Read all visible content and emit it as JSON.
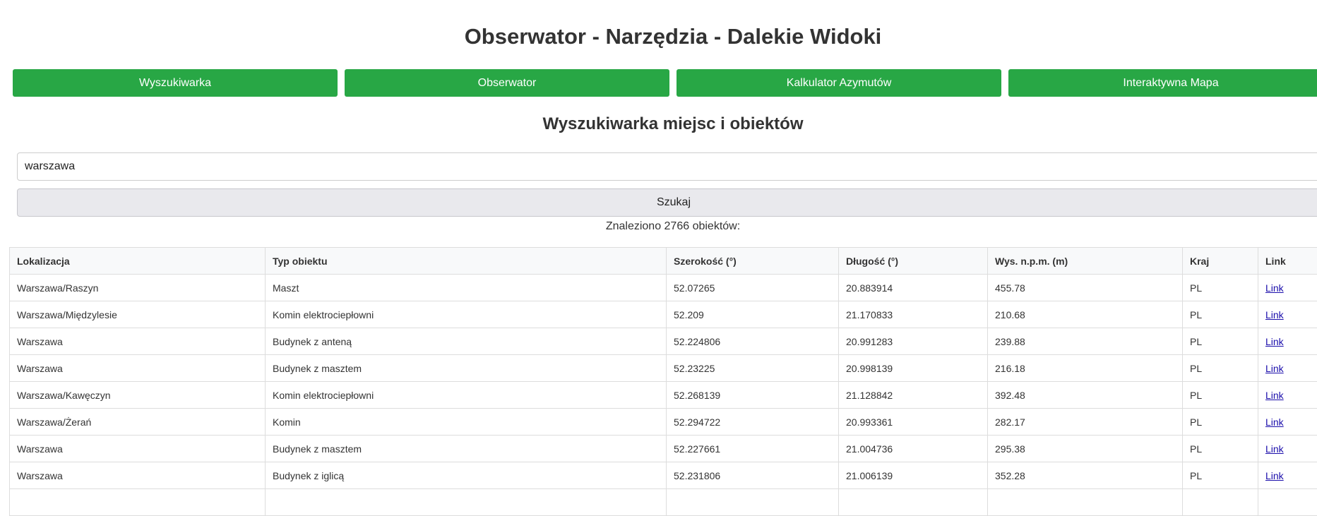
{
  "page": {
    "title": "Obserwator - Narzędzia - Dalekie Widoki",
    "section_title": "Wyszukiwarka miejsc i obiektów"
  },
  "nav": {
    "items": [
      "Wyszukiwarka",
      "Obserwator",
      "Kalkulator Azymutów",
      "Interaktywna Mapa"
    ],
    "color": "#28a745"
  },
  "search": {
    "value": "warszawa",
    "button_label": "Szukaj",
    "result_count": "Znaleziono 2766 obiektów:"
  },
  "table": {
    "headers": [
      "Lokalizacja",
      "Typ obiektu",
      "Szerokość (°)",
      "Długość (°)",
      "Wys. n.p.m. (m)",
      "Kraj",
      "Link"
    ],
    "rows": [
      {
        "location": "Warszawa/Raszyn",
        "type": "Maszt",
        "lat": "52.07265",
        "lon": "20.883914",
        "alt": "455.78",
        "country": "PL",
        "link": "Link"
      },
      {
        "location": "Warszawa/Międzylesie",
        "type": "Komin elektrociepłowni",
        "lat": "52.209",
        "lon": "21.170833",
        "alt": "210.68",
        "country": "PL",
        "link": "Link"
      },
      {
        "location": "Warszawa",
        "type": "Budynek z anteną",
        "lat": "52.224806",
        "lon": "20.991283",
        "alt": "239.88",
        "country": "PL",
        "link": "Link"
      },
      {
        "location": "Warszawa",
        "type": "Budynek z masztem",
        "lat": "52.23225",
        "lon": "20.998139",
        "alt": "216.18",
        "country": "PL",
        "link": "Link"
      },
      {
        "location": "Warszawa/Kawęczyn",
        "type": "Komin elektrociepłowni",
        "lat": "52.268139",
        "lon": "21.128842",
        "alt": "392.48",
        "country": "PL",
        "link": "Link"
      },
      {
        "location": "Warszawa/Żerań",
        "type": "Komin",
        "lat": "52.294722",
        "lon": "20.993361",
        "alt": "282.17",
        "country": "PL",
        "link": "Link"
      },
      {
        "location": "Warszawa",
        "type": "Budynek z masztem",
        "lat": "52.227661",
        "lon": "21.004736",
        "alt": "295.38",
        "country": "PL",
        "link": "Link"
      },
      {
        "location": "Warszawa",
        "type": "Budynek z iglicą",
        "lat": "52.231806",
        "lon": "21.006139",
        "alt": "352.28",
        "country": "PL",
        "link": "Link"
      },
      {
        "location": "",
        "type": "",
        "lat": "",
        "lon": "",
        "alt": "",
        "country": "",
        "link": ""
      }
    ]
  }
}
